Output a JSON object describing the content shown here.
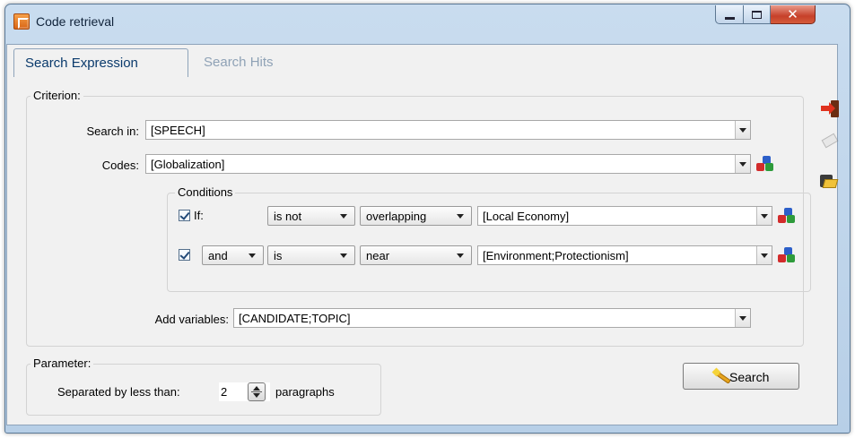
{
  "window": {
    "title": "Code retrieval"
  },
  "tabs": [
    {
      "label": "Search Expression",
      "active": true
    },
    {
      "label": "Search Hits",
      "active": false
    }
  ],
  "criterion": {
    "label": "Criterion:",
    "search_in": {
      "label": "Search in:",
      "value": "[SPEECH]"
    },
    "codes": {
      "label": "Codes:",
      "value": "[Globalization]"
    },
    "conditions": {
      "label": "Conditions",
      "rows": [
        {
          "checked": true,
          "connector": "If:",
          "operator": "is not",
          "relation": "overlapping",
          "codes": "[Local Economy]"
        },
        {
          "checked": true,
          "connector": "and",
          "operator": "is",
          "relation": "near",
          "codes": "[Environment;Protectionism]"
        }
      ]
    },
    "add_variables": {
      "label": "Add variables:",
      "value": "[CANDIDATE;TOPIC]"
    }
  },
  "parameter": {
    "label": "Parameter:",
    "separated_label": "Separated by less than:",
    "value": "2",
    "unit": "paragraphs"
  },
  "search_button": {
    "label": "Search"
  },
  "icons": {
    "side": [
      "exit-icon",
      "eraser-icon",
      "open-folder-icon"
    ],
    "code_selector": "code-cubes-icon"
  }
}
